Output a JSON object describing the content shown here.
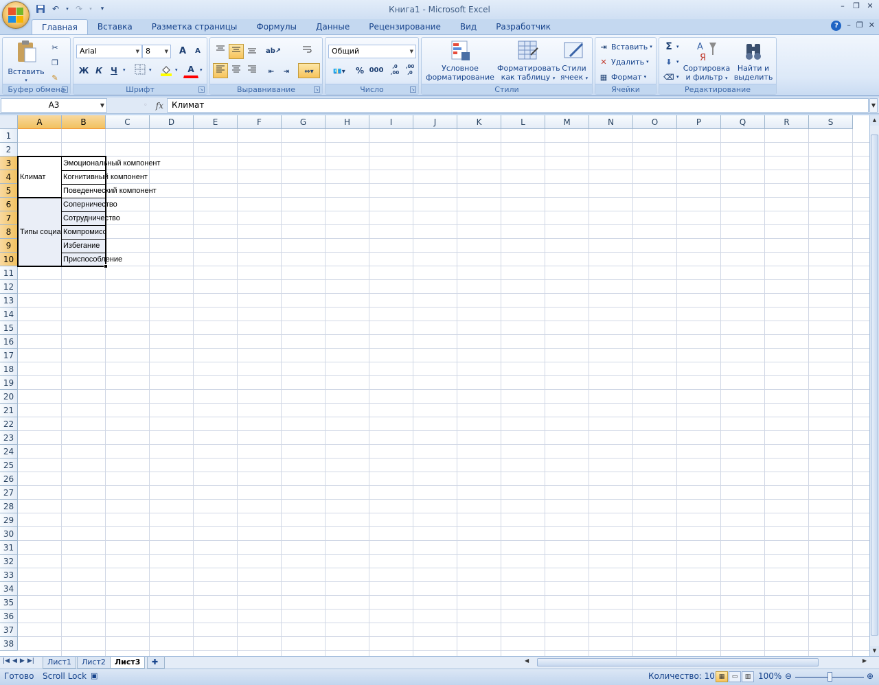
{
  "window": {
    "title": "Книга1 - Microsoft Excel"
  },
  "ribbon": {
    "tabs": [
      "Главная",
      "Вставка",
      "Разметка страницы",
      "Формулы",
      "Данные",
      "Рецензирование",
      "Вид",
      "Разработчик"
    ],
    "active_tab": "Главная",
    "clipboard": {
      "label": "Буфер обмена",
      "paste": "Вставить"
    },
    "font": {
      "label": "Шрифт",
      "name": "Arial",
      "size": "8",
      "bold": "Ж",
      "italic": "К",
      "underline": "Ч",
      "grow": "A",
      "shrink": "A",
      "font_color": "A",
      "font_color_hex": "#ff0000",
      "fill_color_hex": "#ffff00"
    },
    "alignment": {
      "label": "Выравнивание"
    },
    "number": {
      "label": "Число",
      "format": "Общий",
      "percent": "%",
      "thousands": "000",
      "inc_decimal": ",0 ,00",
      "dec_decimal": ",00 ,0"
    },
    "styles": {
      "label": "Стили",
      "conditional_1": "Условное",
      "conditional_2": "форматирование",
      "format_table_1": "Форматировать",
      "format_table_2": "как таблицу",
      "cell_styles_1": "Стили",
      "cell_styles_2": "ячеек"
    },
    "cells": {
      "label": "Ячейки",
      "insert": "Вставить",
      "delete": "Удалить",
      "format": "Формат"
    },
    "editing": {
      "label": "Редактирование",
      "sort_1": "Сортировка",
      "sort_2": "и фильтр",
      "find_1": "Найти и",
      "find_2": "выделить",
      "sum": "Σ"
    }
  },
  "formula_bar": {
    "name_box": "A3",
    "fx": "fx",
    "value": "Климат"
  },
  "sheet": {
    "columns": [
      "A",
      "B",
      "C",
      "D",
      "E",
      "F",
      "G",
      "H",
      "I",
      "J",
      "K",
      "L",
      "M",
      "N",
      "O",
      "P",
      "Q",
      "R",
      "S"
    ],
    "rows": [
      "1",
      "2",
      "3",
      "4",
      "5",
      "6",
      "7",
      "8",
      "9",
      "10",
      "11",
      "12",
      "13",
      "14",
      "15",
      "16",
      "17",
      "18",
      "19",
      "20",
      "21",
      "22",
      "23",
      "24",
      "25",
      "26",
      "27",
      "28",
      "29",
      "30",
      "31",
      "32",
      "33",
      "34",
      "35",
      "36",
      "37",
      "38"
    ],
    "selected_columns": [
      "A",
      "B"
    ],
    "selected_rows": [
      "3",
      "4",
      "5",
      "6",
      "7",
      "8",
      "9",
      "10"
    ],
    "cells": {
      "A3": "Климат",
      "A8": "Типы социа",
      "B3": "Эмоциональный компонент",
      "B4": "Когнитивный компонент",
      "B5": "Поведенческий компонент",
      "B6": "Соперничество",
      "B7": "Сотрудничество",
      "B8": "Компромисс",
      "B9": "Избегание",
      "B10": "Приспособление"
    }
  },
  "sheet_tabs": [
    "Лист1",
    "Лист2",
    "Лист3"
  ],
  "active_sheet": "Лист3",
  "status": {
    "ready": "Готово",
    "scroll_lock": "Scroll Lock",
    "count": "Количество: 10",
    "zoom": "100%"
  }
}
